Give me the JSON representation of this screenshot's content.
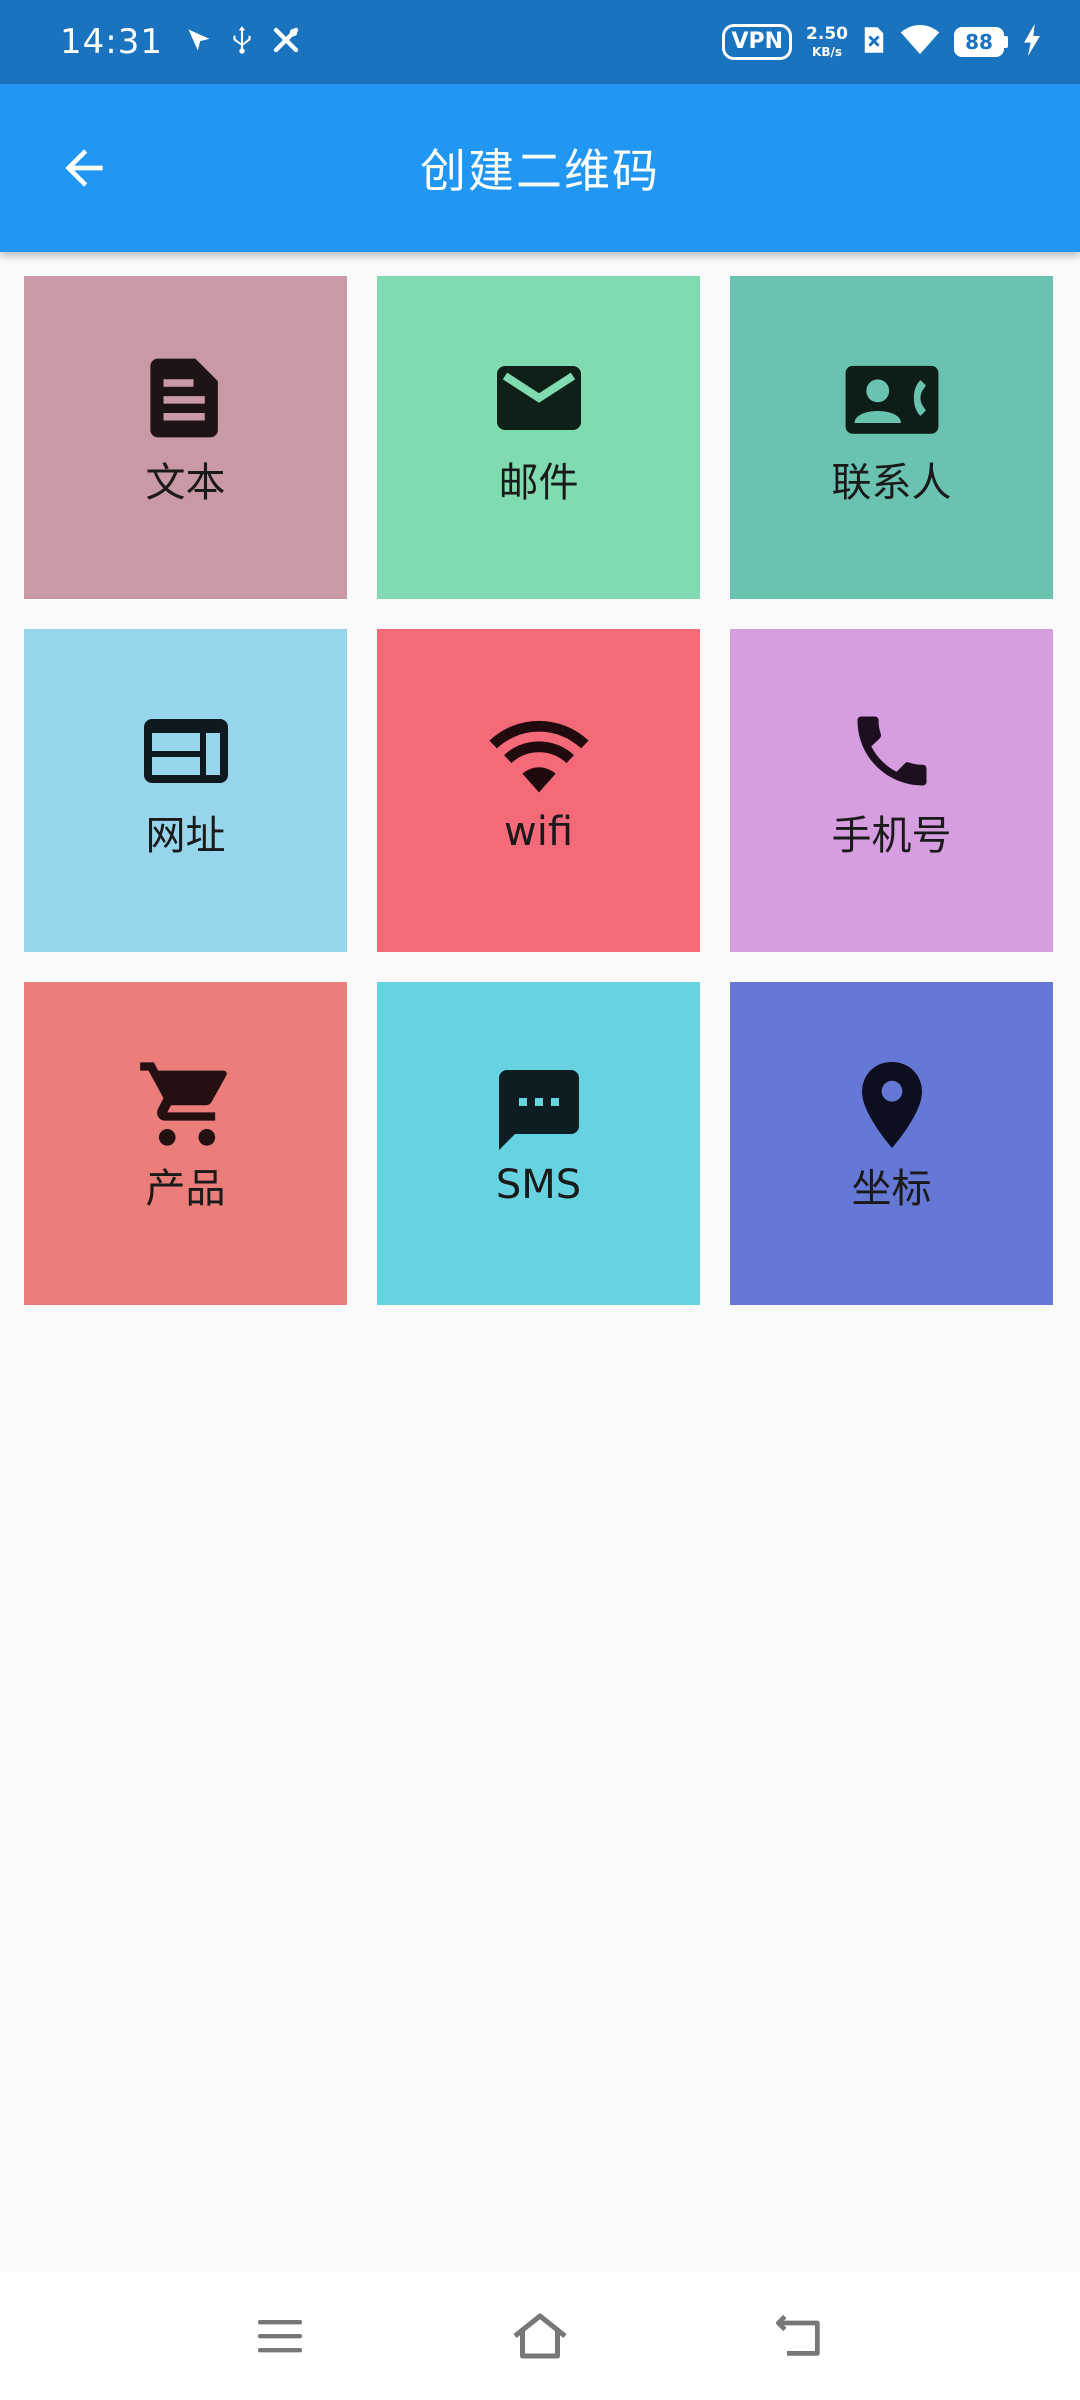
{
  "status_bar": {
    "time": "14:31",
    "vpn": "VPN",
    "net_speed_value": "2.50",
    "net_speed_unit": "KB/s",
    "battery": "88",
    "icons": [
      "send-icon",
      "usb-icon",
      "tools-icon",
      "vpn-icon",
      "sim-blocked-icon",
      "wifi-icon",
      "battery-icon",
      "charging-icon"
    ]
  },
  "app_bar": {
    "title": "创建二维码",
    "back_icon": "arrow-left-icon"
  },
  "tiles": [
    {
      "label": "文本",
      "icon": "text-document-icon",
      "color": "#c99aa6"
    },
    {
      "label": "邮件",
      "icon": "mail-icon",
      "color": "#80dbb0"
    },
    {
      "label": "联系人",
      "icon": "contact-phone-icon",
      "color": "#69c3b0"
    },
    {
      "label": "网址",
      "icon": "web-icon",
      "color": "#96d5ec"
    },
    {
      "label": "wifi",
      "icon": "wifi-icon",
      "color": "#f56a78"
    },
    {
      "label": "手机号",
      "icon": "phone-icon",
      "color": "#d69de0"
    },
    {
      "label": "产品",
      "icon": "shopping-cart-icon",
      "color": "#eb7d7b"
    },
    {
      "label": "SMS",
      "icon": "sms-icon",
      "color": "#67d3e0"
    },
    {
      "label": "坐标",
      "icon": "location-pin-icon",
      "color": "#6678d6"
    }
  ],
  "nav_bar": {
    "icons": [
      "menu-icon",
      "home-icon",
      "back-icon"
    ]
  }
}
